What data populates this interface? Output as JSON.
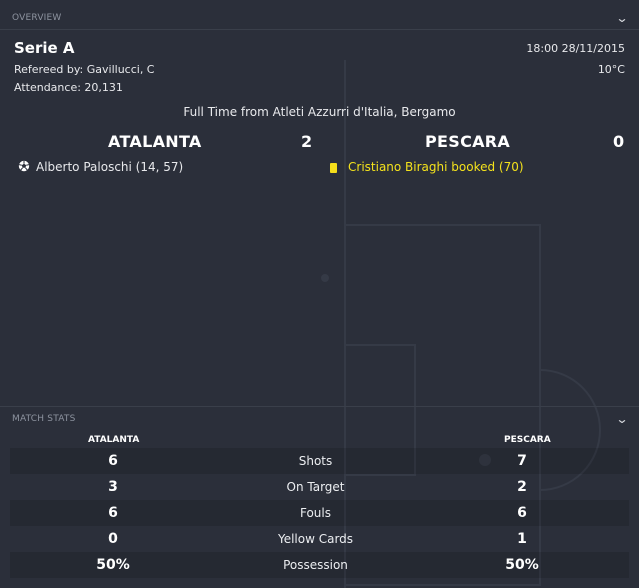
{
  "overview": {
    "section_title": "OVERVIEW",
    "competition": "Serie A",
    "referee": "Refereed by: Gavillucci, C",
    "attendance": "Attendance: 20,131",
    "kickoff": "18:00 28/11/2015",
    "temperature": "10°C",
    "result_line": "Full Time from Atleti Azzurri d'Italia, Bergamo",
    "home_team": "ATALANTA",
    "home_score": "2",
    "away_team": "PESCARA",
    "away_score": "0",
    "home_events": [
      {
        "icon": "football-icon",
        "text": "Alberto Paloschi (14, 57)"
      }
    ],
    "away_events": [
      {
        "icon": "yellow-card-icon",
        "text": "Cristiano Biraghi booked (70)"
      }
    ]
  },
  "match_stats": {
    "section_title": "MATCH STATS",
    "home_header": "ATALANTA",
    "away_header": "PESCARA",
    "rows": [
      {
        "label": "Shots",
        "home": "6",
        "away": "7"
      },
      {
        "label": "On Target",
        "home": "3",
        "away": "2"
      },
      {
        "label": "Fouls",
        "home": "6",
        "away": "6"
      },
      {
        "label": "Yellow Cards",
        "home": "0",
        "away": "1"
      },
      {
        "label": "Possession",
        "home": "50%",
        "away": "50%"
      }
    ]
  },
  "colors": {
    "background": "#2b2f3a",
    "yellow_card": "#f5de1b",
    "yellow_text": "#f4e21c",
    "muted_text": "#8d939f"
  }
}
